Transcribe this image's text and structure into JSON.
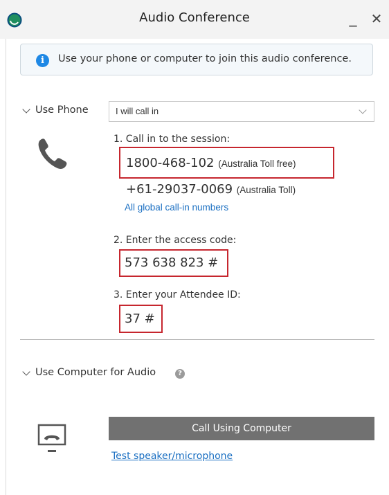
{
  "window": {
    "title": "Audio Conference",
    "minimize_label": "_",
    "close_label": "✕"
  },
  "banner": {
    "icon_glyph": "i",
    "text": "Use your phone or computer to join this audio conference."
  },
  "phone_section": {
    "toggle_label": "Use Phone",
    "select_value": "I will call in",
    "step1_label": "1. Call in to the session:",
    "number1": "1800-468-102",
    "number1_note": "(Australia Toll free)",
    "number2": "+61-29037-0069",
    "number2_note": "(Australia Toll)",
    "global_link": "All global call-in numbers",
    "step2_label": "2. Enter the access code:",
    "access_code": "573 638 823 #",
    "step3_label": "3. Enter your Attendee ID:",
    "attendee_id": "37 #"
  },
  "computer_section": {
    "toggle_label": "Use Computer for Audio",
    "help_glyph": "?",
    "call_button": "Call Using Computer",
    "test_link": "Test speaker/microphone"
  },
  "icons": {
    "logo": "app-logo-icon",
    "info": "info-icon",
    "phone": "phone-handset-icon",
    "computer": "computer-audio-icon",
    "help": "help-icon"
  },
  "colors": {
    "highlight": "#c6262e",
    "link": "#1a6fc2",
    "info_blue": "#1e88e5",
    "button_gray": "#717171"
  }
}
